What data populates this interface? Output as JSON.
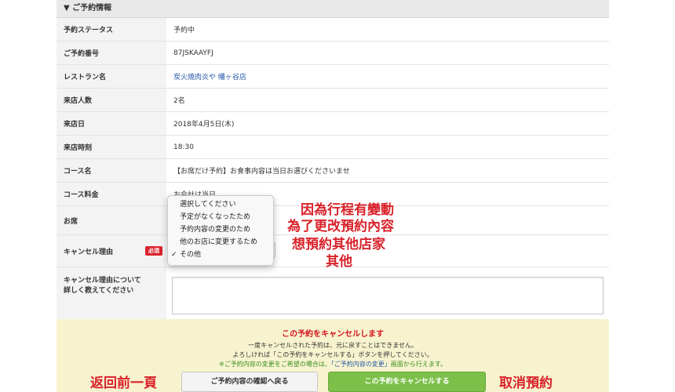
{
  "section_title": "▼ ご予約情報",
  "rows": [
    {
      "label": "予約ステータス",
      "value": "予約中"
    },
    {
      "label": "ご予約番号",
      "value": "87JSKAAYFJ"
    },
    {
      "label": "レストラン名",
      "value": "炭火焼肉炎や 幡ヶ谷店"
    },
    {
      "label": "来店人数",
      "value": "2名"
    },
    {
      "label": "来店日",
      "value": "2018年4月5日(木)"
    },
    {
      "label": "来店時刻",
      "value": "18:30"
    },
    {
      "label": "コース名",
      "value": "【お席だけ予約】お食事内容は当日お選びくださいませ"
    },
    {
      "label": "コース料金",
      "value": "お会計は当日"
    },
    {
      "label": "お席",
      "value": ""
    },
    {
      "label": "キャンセル理由",
      "value": "",
      "badge": "必須"
    },
    {
      "label": "キャンセル理由について\n詳しく教えてください",
      "value": ""
    }
  ],
  "dropdown": {
    "options": [
      "選択してください",
      "予定がなくなったため",
      "予約内容の変更のため",
      "他のお店に変更するため",
      "その他"
    ],
    "selected_check": "✓"
  },
  "confirm": {
    "title": "この予約をキャンセルします",
    "line1": "一度キャンセルされた予約は、元に戻すことはできません。",
    "line2": "よろしければ「この予約をキャンセルする」ボタンを押してください。",
    "line3_prefix": "※ご予約内容の変更をご希望の場合は、",
    "line3_link": "「ご予約内容の変更」",
    "line3_suffix": "画面から行えます。",
    "back_button": "ご予約内容の確認へ戻る",
    "cancel_button": "この予約をキャンセルする"
  },
  "annotations": {
    "reasons": [
      "因為行程有變動",
      "為了更改預約內容",
      "想預約其他店家",
      "其他"
    ],
    "back": "返回前一頁",
    "cancel": "取消預約"
  },
  "colors": {
    "accent_red": "#d9222a",
    "button_green": "#7cc04a",
    "link_blue": "#2458a8"
  }
}
